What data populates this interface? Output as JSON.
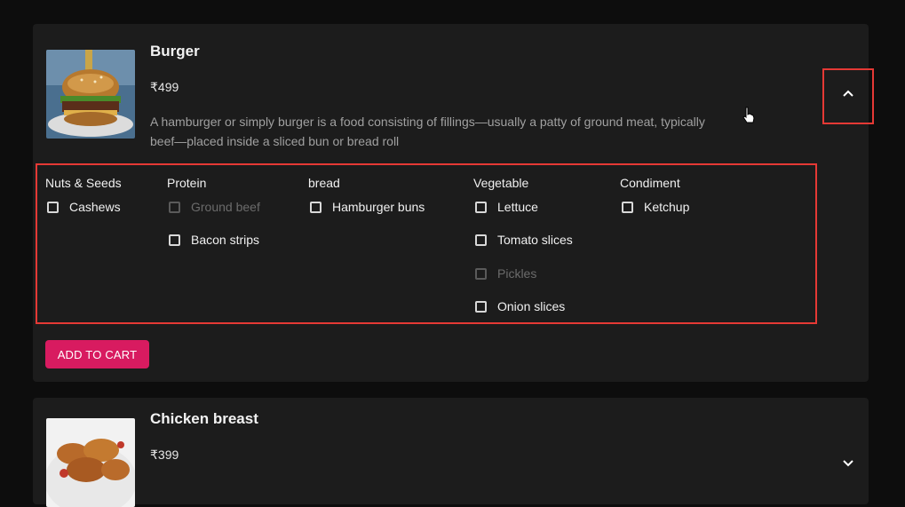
{
  "products": [
    {
      "title": "Burger",
      "price": "₹499",
      "description": "A hamburger or simply burger is a food consisting of fillings—usually a patty of ground meat, typically beef—placed inside a sliced bun or bread roll",
      "toggle_icon": "chevron-up-icon",
      "expanded": true,
      "add_to_cart_label": "ADD TO CART",
      "option_groups": [
        {
          "title": "Nuts & Seeds",
          "options": [
            {
              "label": "Cashews",
              "disabled": false,
              "checked": false
            }
          ]
        },
        {
          "title": "Protein",
          "options": [
            {
              "label": "Ground beef",
              "disabled": true,
              "checked": false
            },
            {
              "label": "Bacon strips",
              "disabled": false,
              "checked": false
            }
          ]
        },
        {
          "title": "bread",
          "options": [
            {
              "label": "Hamburger buns",
              "disabled": false,
              "checked": false
            }
          ]
        },
        {
          "title": "Vegetable",
          "options": [
            {
              "label": "Lettuce",
              "disabled": false,
              "checked": false
            },
            {
              "label": "Tomato slices",
              "disabled": false,
              "checked": false
            },
            {
              "label": "Pickles",
              "disabled": true,
              "checked": false
            },
            {
              "label": "Onion slices",
              "disabled": false,
              "checked": false
            }
          ]
        },
        {
          "title": "Condiment",
          "options": [
            {
              "label": "Ketchup",
              "disabled": false,
              "checked": false
            }
          ]
        }
      ]
    },
    {
      "title": "Chicken breast",
      "price": "₹399",
      "toggle_icon": "chevron-down-icon",
      "expanded": false
    }
  ],
  "colors": {
    "accent": "#d81b60",
    "highlight": "#e53935",
    "card": "#1c1c1c",
    "background": "#0d0d0d"
  }
}
